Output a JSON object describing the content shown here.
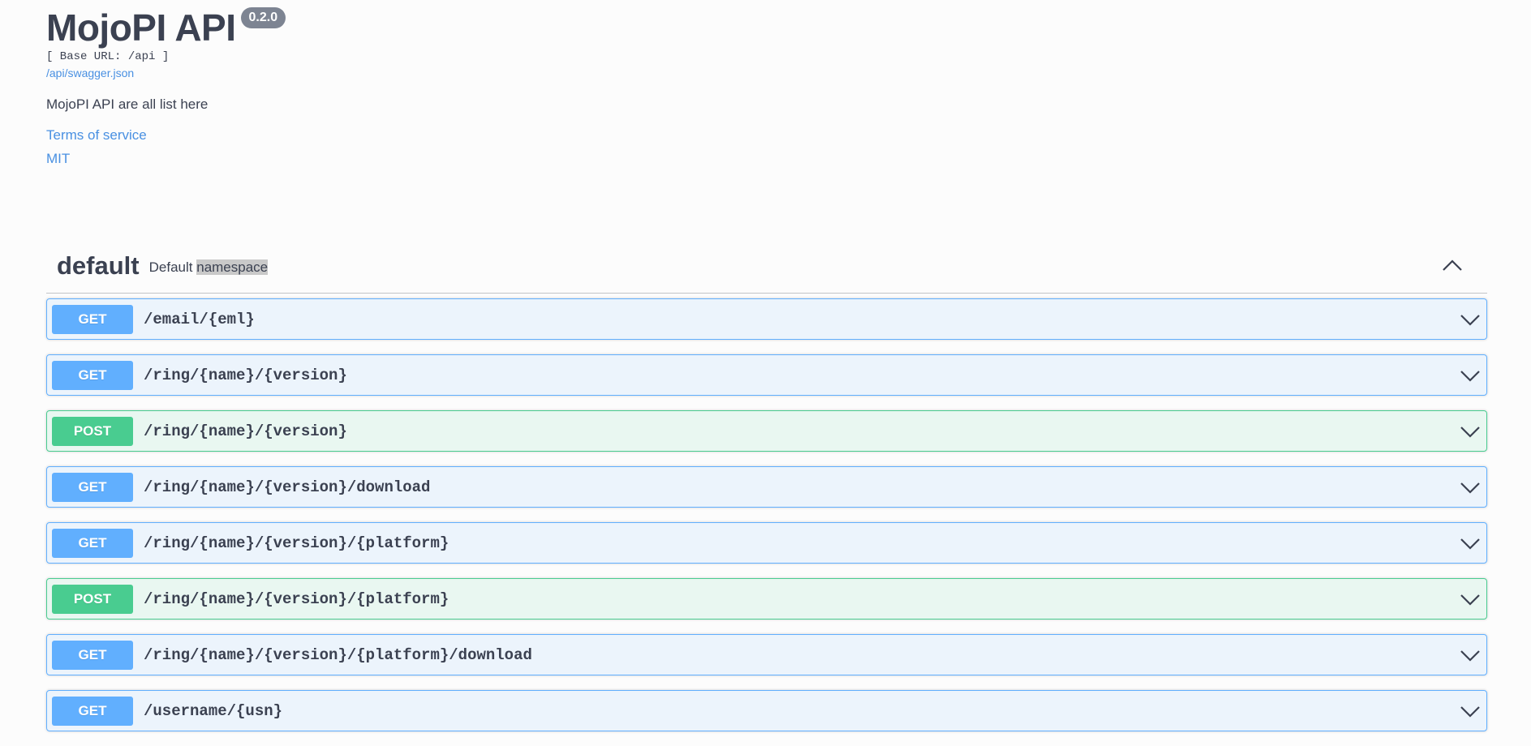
{
  "info": {
    "title": "MojoPI API",
    "version": "0.2.0",
    "base_url": "[ Base URL: /api ]",
    "swagger_link": "/api/swagger.json",
    "description": "MojoPI API are all list here",
    "terms": "Terms of service",
    "license": "MIT"
  },
  "tag": {
    "name": "default",
    "desc_prefix": "Default",
    "desc_highlight": "namespace",
    "chevron_icon": "chevron-up-icon"
  },
  "operations": [
    {
      "method": "GET",
      "path": "/email/{eml}"
    },
    {
      "method": "GET",
      "path": "/ring/{name}/{version}"
    },
    {
      "method": "POST",
      "path": "/ring/{name}/{version}"
    },
    {
      "method": "GET",
      "path": "/ring/{name}/{version}/download"
    },
    {
      "method": "GET",
      "path": "/ring/{name}/{version}/{platform}"
    },
    {
      "method": "POST",
      "path": "/ring/{name}/{version}/{platform}"
    },
    {
      "method": "GET",
      "path": "/ring/{name}/{version}/{platform}/download"
    },
    {
      "method": "GET",
      "path": "/username/{usn}"
    }
  ],
  "colors": {
    "get": "#61affe",
    "post": "#49cc90",
    "link": "#4990e2",
    "text": "#3b4151"
  }
}
